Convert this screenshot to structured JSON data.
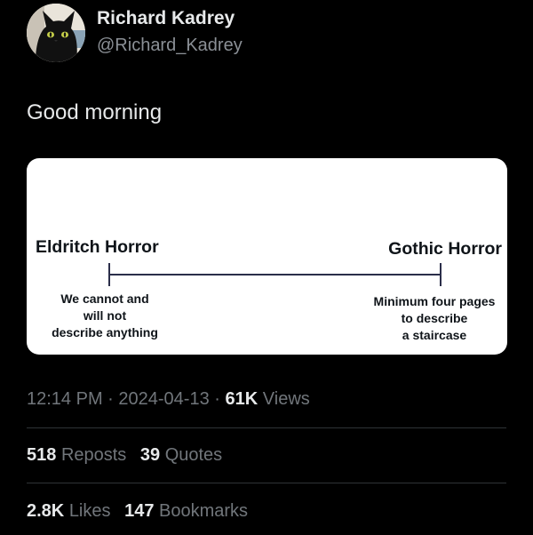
{
  "author": {
    "display_name": "Richard Kadrey",
    "handle": "@Richard_Kadrey",
    "avatar_icon": "black-cat-avatar"
  },
  "tweet": {
    "text": "Good morning"
  },
  "media": {
    "left_title": "Eldritch Horror",
    "right_title": "Gothic Horror",
    "left_caption": [
      "We cannot and",
      "will not",
      "describe anything"
    ],
    "right_caption": [
      "Minimum four pages",
      "to describe",
      "a staircase"
    ]
  },
  "meta": {
    "time": "12:14 PM",
    "separator": "·",
    "date": "2024-04-13",
    "views_count": "61K",
    "views_label": "Views"
  },
  "stats": {
    "reposts_count": "518",
    "reposts_label": "Reposts",
    "quotes_count": "39",
    "quotes_label": "Quotes",
    "likes_count": "2.8K",
    "likes_label": "Likes",
    "bookmarks_count": "147",
    "bookmarks_label": "Bookmarks"
  },
  "colors": {
    "background": "#000000",
    "primary_text": "#e7e9ea",
    "secondary_text": "#71767b",
    "divider": "#2f3336"
  }
}
